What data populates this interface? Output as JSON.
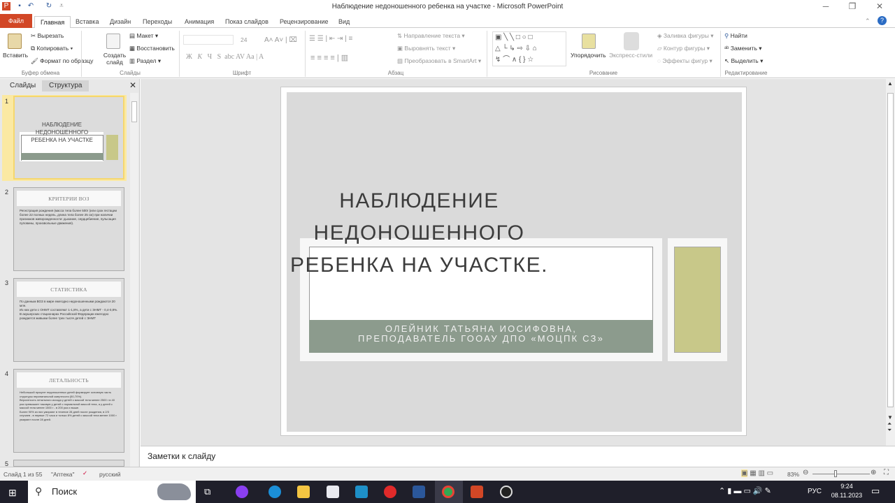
{
  "window": {
    "title": "Наблюдение недоношенного ребенка на участке - Microsoft PowerPoint"
  },
  "tabs": [
    "Файл",
    "Главная",
    "Вставка",
    "Дизайн",
    "Переходы",
    "Анимация",
    "Показ слайдов",
    "Рецензирование",
    "Вид"
  ],
  "ribbon": {
    "clipboard": {
      "paste": "Вставить",
      "cut": "Вырезать",
      "copy": "Копировать",
      "format_painter": "Формат по образцу",
      "label": "Буфер обмена"
    },
    "slides": {
      "new_slide": "Создать слайд",
      "layout": "Макет",
      "reset": "Восстановить",
      "section": "Раздел",
      "label": "Слайды"
    },
    "font": {
      "size": "24",
      "bold": "Ж",
      "italic": "К",
      "underline": "Ч",
      "shadow": "S",
      "label": "Шрифт"
    },
    "paragraph": {
      "text_direction": "Направление текста",
      "align_text": "Выровнять текст",
      "smartart": "Преобразовать в SmartArt",
      "label": "Абзац"
    },
    "drawing": {
      "arrange": "Упорядочить",
      "quick_styles": "Экспресс-стили",
      "fill": "Заливка фигуры",
      "outline": "Контур фигуры",
      "effects": "Эффекты фигур",
      "label": "Рисование"
    },
    "editing": {
      "find": "Найти",
      "replace": "Заменить",
      "select": "Выделить",
      "label": "Редактирование"
    }
  },
  "panel": {
    "tabs": [
      "Слайды",
      "Структура"
    ]
  },
  "thumbnails": [
    {
      "num": "1",
      "l1": "НАБЛЮДЕНИЕ",
      "l2": "НЕДОНОШЕННОГО",
      "l3": "РЕБЕНКА НА УЧАСТКЕ"
    },
    {
      "num": "2",
      "title": "КРИТЕРИИ ВОЗ",
      "body": "Регистрация рождения (масса тела более 500г (или срок гестации более 22 полных недель, длина тела более 25 см) при наличии признаков живорожденности: дыхание, сердцебиение, пульсация пуповины, произвольные движения)."
    },
    {
      "num": "3",
      "title": "СТАТИСТИКА",
      "b1": "По данным ВОЗ в мире ежегодно недоношенными рождаются 20 млн.",
      "b2": "Из них дети с ОНМТ составляют 1-1,8%, а дети с ЭНМТ - 0,4-0,8%.",
      "b3": "В акушерских стационарах Российской Федерации ежегодно рождается живыми более трех тысяч детей с ЭНМТ"
    },
    {
      "num": "4",
      "title": "ЛЕТАЛЬНОСТЬ",
      "b1": "Небольшой процент недоношенных детей формирует основную часть структуры перинатальной смертности (50-70%).",
      "b2": "Вероятность летального исхода у детей с массой тела менее 2500 г в 40 раз превышает таковую у детей с нормальной массой тела, а у детей с массой тела менее 1500 г - в 200 раз и выше.",
      "b3": "Более 90% из них умирают в течение 28 дней после рождения, в 2/3 случаев - в первые 72 часа и только 8% детей с массой тела менее 1000 г умирают после 28 дней."
    },
    {
      "num": "5"
    }
  ],
  "slide": {
    "title_lines": [
      "НАБЛЮДЕНИЕ",
      "НЕДОНОШЕННОГО",
      "РЕБЕНКА НА УЧАСТКЕ."
    ],
    "subtitle_lines": [
      "ОЛЕЙНИК ТАТЬЯНА ИОСИФОВНА,",
      "ПРЕПОДАВАТЕЛЬ ГООАУ ДПО «МОЦПК СЗ»"
    ]
  },
  "notes": {
    "placeholder": "Заметки к слайду"
  },
  "status": {
    "slide": "Слайд 1 из 55",
    "theme": "\"Аптека\"",
    "language": "русский",
    "zoom": "83%",
    "zoom_value": 83
  },
  "taskbar": {
    "search": "Поиск",
    "time": "9:24",
    "date": "08.11.2023",
    "lang": "РУС"
  },
  "colors": {
    "file_tab": "#d24726",
    "band": "#8c9b8d",
    "olive": "#c8c889",
    "slide_bg": "#dadada"
  }
}
